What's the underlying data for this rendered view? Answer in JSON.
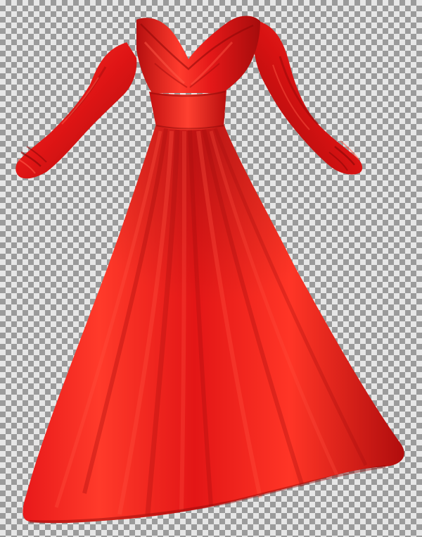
{
  "image": {
    "subject": "dress",
    "background": "transparency-checkerboard"
  },
  "colors": {
    "checker_light": "#e6e6e6",
    "checker_dark": "#9b9b9b",
    "fabric_base": "#e01515",
    "fabric_highlight": "#ff4a3a",
    "fabric_shadow": "#a30c0c",
    "fabric_deep_shadow": "#7a0606"
  }
}
